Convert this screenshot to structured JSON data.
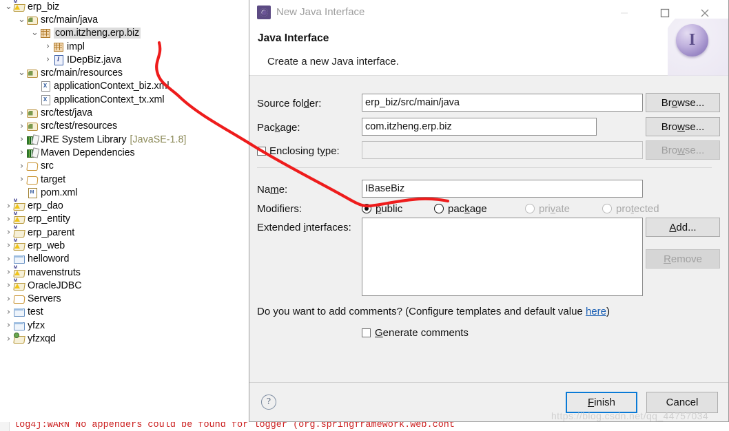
{
  "explorer": {
    "name": "package-explorer",
    "rows": [
      {
        "indent": 0,
        "twist": "v",
        "icon": "ic-projw",
        "label": "erp_biz",
        "suffix": "",
        "selected": false
      },
      {
        "indent": 1,
        "twist": "v",
        "icon": "ic-srcpkg",
        "label": "src/main/java",
        "suffix": "",
        "selected": false
      },
      {
        "indent": 2,
        "twist": "v",
        "icon": "ic-pkg",
        "label": "com.itzheng.erp.biz",
        "suffix": "",
        "selected": true
      },
      {
        "indent": 3,
        "twist": ">",
        "icon": "ic-pkg",
        "label": "impl",
        "suffix": "",
        "selected": false
      },
      {
        "indent": 3,
        "twist": ">",
        "icon": "ic-iface",
        "label": "IDepBiz.java",
        "suffix": "",
        "selected": false
      },
      {
        "indent": 1,
        "twist": "v",
        "icon": "ic-srcpkg",
        "label": "src/main/resources",
        "suffix": "",
        "selected": false
      },
      {
        "indent": 2,
        "twist": "",
        "icon": "ic-xml",
        "label": "applicationContext_biz.xml",
        "suffix": "",
        "selected": false
      },
      {
        "indent": 2,
        "twist": "",
        "icon": "ic-xml",
        "label": "applicationContext_tx.xml",
        "suffix": "",
        "selected": false
      },
      {
        "indent": 1,
        "twist": ">",
        "icon": "ic-srcpkg",
        "label": "src/test/java",
        "suffix": "",
        "selected": false
      },
      {
        "indent": 1,
        "twist": ">",
        "icon": "ic-srcpkg",
        "label": "src/test/resources",
        "suffix": "",
        "selected": false
      },
      {
        "indent": 1,
        "twist": ">",
        "icon": "ic-lib",
        "label": "JRE System Library",
        "suffix": "[JavaSE-1.8]",
        "selected": false
      },
      {
        "indent": 1,
        "twist": ">",
        "icon": "ic-lib",
        "label": "Maven Dependencies",
        "suffix": "",
        "selected": false
      },
      {
        "indent": 1,
        "twist": ">",
        "icon": "ic-folder",
        "label": "src",
        "suffix": "",
        "selected": false
      },
      {
        "indent": 1,
        "twist": ">",
        "icon": "ic-folder",
        "label": "target",
        "suffix": "",
        "selected": false
      },
      {
        "indent": 1,
        "twist": "",
        "icon": "ic-pom",
        "label": "pom.xml",
        "suffix": "",
        "selected": false
      },
      {
        "indent": 0,
        "twist": ">",
        "icon": "ic-projw",
        "label": "erp_dao",
        "suffix": "",
        "selected": false
      },
      {
        "indent": 0,
        "twist": ">",
        "icon": "ic-projw",
        "label": "erp_entity",
        "suffix": "",
        "selected": false
      },
      {
        "indent": 0,
        "twist": ">",
        "icon": "ic-projp",
        "label": "erp_parent",
        "suffix": "",
        "selected": false
      },
      {
        "indent": 0,
        "twist": ">",
        "icon": "ic-projw",
        "label": "erp_web",
        "suffix": "",
        "selected": false
      },
      {
        "indent": 0,
        "twist": ">",
        "icon": "ic-blue",
        "label": "helloword",
        "suffix": "",
        "selected": false
      },
      {
        "indent": 0,
        "twist": ">",
        "icon": "ic-projw",
        "label": "mavenstruts",
        "suffix": "",
        "selected": false
      },
      {
        "indent": 0,
        "twist": ">",
        "icon": "ic-projw",
        "label": "OracleJDBC",
        "suffix": "",
        "selected": false
      },
      {
        "indent": 0,
        "twist": ">",
        "icon": "ic-folder",
        "label": "Servers",
        "suffix": "",
        "selected": false
      },
      {
        "indent": 0,
        "twist": ">",
        "icon": "ic-blue",
        "label": "test",
        "suffix": "",
        "selected": false
      },
      {
        "indent": 0,
        "twist": ">",
        "icon": "ic-blue",
        "label": "yfzx",
        "suffix": "",
        "selected": false
      },
      {
        "indent": 0,
        "twist": ">",
        "icon": "ic-projg",
        "label": "yfzxqd",
        "suffix": "",
        "selected": false
      }
    ]
  },
  "dialog": {
    "window_title": "New Java Interface",
    "heading": "Java Interface",
    "subheading": "Create a new Java interface.",
    "hero_letter": "I",
    "labels": {
      "source_folder": "Source fol",
      "source_folder_mnem": "d",
      "source_folder_tail": "er:",
      "package": "Pac",
      "package_mnem": "k",
      "package_tail": "age:",
      "enclosing_type": "Enclosing t",
      "enclosing_type_mnem": "y",
      "enclosing_type_tail": "pe:",
      "name": "Na",
      "name_mnem": "m",
      "name_tail": "e:",
      "modifiers": "Modifiers:",
      "extended_interfaces": "Extended ",
      "extended_interfaces_mnem": "i",
      "extended_interfaces_tail": "nterfaces:"
    },
    "values": {
      "source_folder": "erp_biz/src/main/java",
      "package": "com.itzheng.erp.biz",
      "enclosing_type": "",
      "name": "IBaseBiz"
    },
    "buttons": {
      "browse1_pre": "Br",
      "browse1_mnem": "o",
      "browse1_post": "wse...",
      "browse2_pre": "Bro",
      "browse2_mnem": "w",
      "browse2_post": "se...",
      "browse3_pre": "Bro",
      "browse3_mnem": "w",
      "browse3_post": "se...",
      "add_pre": "",
      "add_mnem": "A",
      "add_post": "dd...",
      "remove_pre": "",
      "remove_mnem": "R",
      "remove_post": "emove",
      "finish_pre": "",
      "finish_mnem": "F",
      "finish_post": "inish",
      "cancel": "Cancel"
    },
    "modifiers": [
      {
        "label_pre": "",
        "mnem": "p",
        "label_post": "ublic",
        "checked": true,
        "disabled": false
      },
      {
        "label_pre": "pac",
        "mnem": "k",
        "label_post": "age",
        "checked": false,
        "disabled": false
      },
      {
        "label_pre": "pri",
        "mnem": "v",
        "label_post": "ate",
        "checked": false,
        "disabled": true
      },
      {
        "label_pre": "pro",
        "mnem": "t",
        "label_post": "ected",
        "checked": false,
        "disabled": true
      }
    ],
    "enclosing_checked": false,
    "comments_question_pre": "Do you want to add comments? (Configure templates and default value ",
    "comments_link": "here",
    "comments_question_post": ")",
    "generate_comments_pre": "",
    "generate_comments_mnem": "G",
    "generate_comments_post": "enerate comments",
    "generate_comments_checked": false
  },
  "annotation": {
    "color": "#ee1c1c",
    "note": "hand-drawn arrow from selected package node to Name field"
  },
  "watermark": "https://blog.csdn.net/qq_44757034",
  "console_text": "log4j:WARN No appenders could be found for logger (org.springframework.web.cont"
}
